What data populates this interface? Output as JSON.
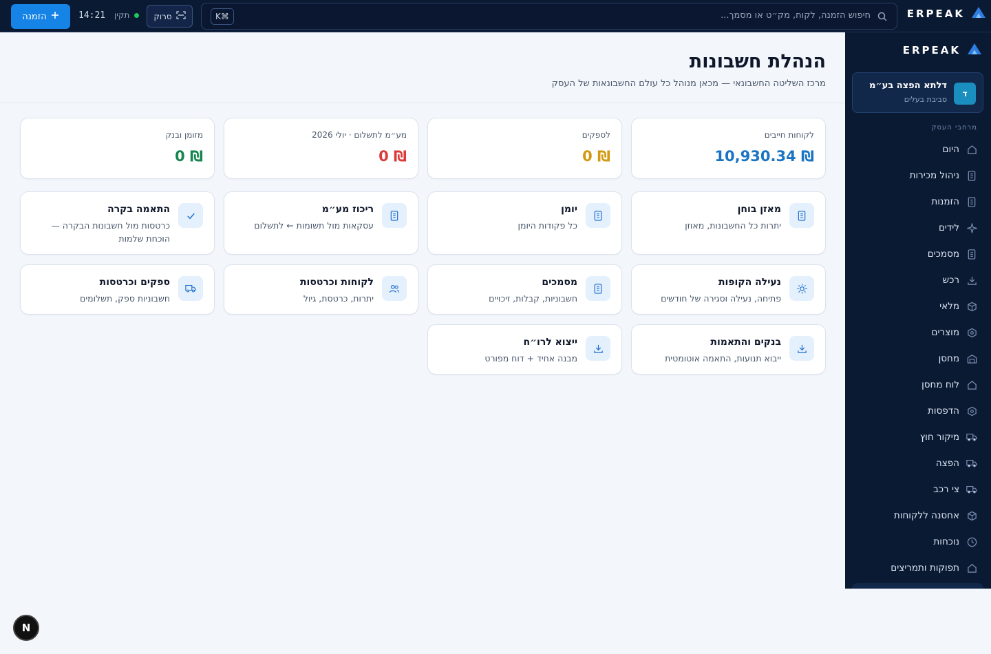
{
  "topbar": {
    "brand": "ERPEAK",
    "search_placeholder": "חיפוש הזמנה, לקוח, מק״ט או מסמך...",
    "shortcut": "K⌘",
    "scan_label": "סרוק",
    "status_label": "תקין",
    "clock": "14:21",
    "new_order_label": "הזמנה"
  },
  "sidebar": {
    "brand": "ERPEAK",
    "org": {
      "avatar": "ד",
      "name": "דלתא הפצה בע״מ",
      "role": "סביבת בעלים"
    },
    "section_label": "מרחבי העסק",
    "items": [
      {
        "label": "היום",
        "icon": "home-icon"
      },
      {
        "label": "ניהול מכירות",
        "icon": "document-icon"
      },
      {
        "label": "הזמנות",
        "icon": "document-icon"
      },
      {
        "label": "לידים",
        "icon": "sparkle-icon"
      },
      {
        "label": "מסמכים",
        "icon": "document-icon"
      },
      {
        "label": "רכש",
        "icon": "download-icon"
      },
      {
        "label": "מלאי",
        "icon": "box-icon"
      },
      {
        "label": "מוצרים",
        "icon": "hexagon-icon"
      },
      {
        "label": "מחסן",
        "icon": "warehouse-icon"
      },
      {
        "label": "לוח מחסן",
        "icon": "home-icon"
      },
      {
        "label": "הדפסות",
        "icon": "hexagon-icon"
      },
      {
        "label": "מיקור חוץ",
        "icon": "truck-icon"
      },
      {
        "label": "הפצה",
        "icon": "truck-icon"
      },
      {
        "label": "צי רכב",
        "icon": "truck-icon"
      },
      {
        "label": "אחסנה ללקוחות",
        "icon": "box-icon"
      },
      {
        "label": "נוכחות",
        "icon": "clock-icon"
      },
      {
        "label": "תפוקות ותמריצים",
        "icon": "home-icon"
      }
    ]
  },
  "page": {
    "title": "הנהלת חשבונות",
    "subtitle": "מרכז השליטה החשבונאי — מכאן מנוהל כל עולם החשבונאות של העסק"
  },
  "stats": [
    {
      "label": "לקוחות חייבים",
      "value": "₪ 10,930.34",
      "color": "#1a74c4"
    },
    {
      "label": "לספקים",
      "value": "₪ 0",
      "color": "#d19a12"
    },
    {
      "label": "מע״מ לתשלום · יולי 2026",
      "value": "₪ 0",
      "color": "#dc3b3b"
    },
    {
      "label": "מזומן ובנק",
      "value": "₪ 0",
      "color": "#15864f"
    }
  ],
  "modules": [
    {
      "title": "מאזן בוחן",
      "desc": "יתרות כל החשבונות, מאוזן",
      "icon": "document-icon"
    },
    {
      "title": "יומן",
      "desc": "כל פקודות היומן",
      "icon": "document-icon"
    },
    {
      "title": "ריכוז מע״מ",
      "desc": "עסקאות מול תשומות ← לתשלום",
      "icon": "document-icon"
    },
    {
      "title": "התאמה בקרה",
      "desc": "כרטסות מול חשבונות הבקרה — הוכחת שלמות",
      "icon": "check-icon"
    },
    {
      "title": "נעילה הקופות",
      "desc": "פתיחה, נעילה וסגירה של חודשים",
      "icon": "sun-icon"
    },
    {
      "title": "מסמכים",
      "desc": "חשבוניות, קבלות, זיכויים",
      "icon": "document-icon"
    },
    {
      "title": "לקוחות וכרטסות",
      "desc": "יתרות, כרטסת, גיול",
      "icon": "users-icon"
    },
    {
      "title": "ספקים וכרטסות",
      "desc": "חשבוניות ספק, תשלומים",
      "icon": "truck-icon"
    },
    {
      "title": "בנקים והתאמות",
      "desc": "ייבוא תנועות, התאמה אוטומטית",
      "icon": "download-icon"
    },
    {
      "title": "ייצוא לרו״ח",
      "desc": "מבנה אחיד + דוח מפורט",
      "icon": "download-icon"
    }
  ],
  "fab_label": "N"
}
